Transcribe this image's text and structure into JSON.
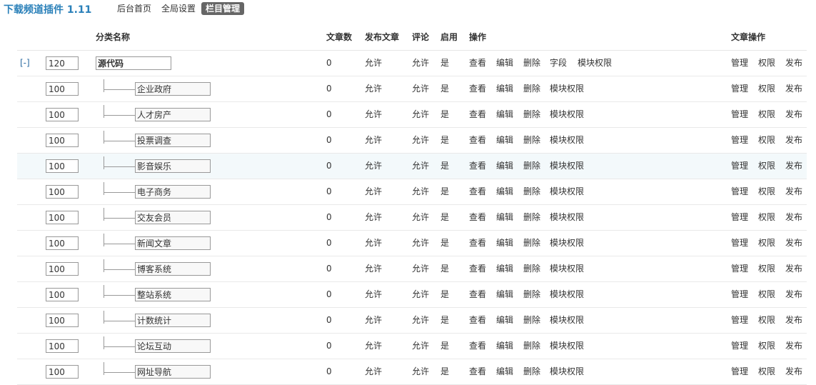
{
  "header": {
    "brand": "下载频道插件  1.11",
    "nav": [
      {
        "label": "后台首页",
        "active": false
      },
      {
        "label": "全局设置",
        "active": false
      },
      {
        "label": "栏目管理",
        "active": true
      }
    ]
  },
  "table": {
    "columns": {
      "name": "分类名称",
      "count": "文章数",
      "post": "发布文章",
      "comment": "评论",
      "enabled": "启用",
      "actions": "操作",
      "article_actions": "文章操作"
    },
    "toggle_label": "[-]",
    "root": {
      "order": "120",
      "name": "源代码",
      "count": "0",
      "post": "允许",
      "comment": "允许",
      "enabled": "是",
      "actions": [
        "查看",
        "编辑",
        "删除",
        "字段",
        "模块权限"
      ],
      "article_actions": [
        "管理",
        "权限",
        "发布"
      ]
    },
    "rows": [
      {
        "order": "100",
        "name": "企业政府",
        "count": "0",
        "post": "允许",
        "comment": "允许",
        "enabled": "是",
        "actions": [
          "查看",
          "编辑",
          "删除",
          "模块权限"
        ],
        "article_actions": [
          "管理",
          "权限",
          "发布"
        ]
      },
      {
        "order": "100",
        "name": "人才房产",
        "count": "0",
        "post": "允许",
        "comment": "允许",
        "enabled": "是",
        "actions": [
          "查看",
          "编辑",
          "删除",
          "模块权限"
        ],
        "article_actions": [
          "管理",
          "权限",
          "发布"
        ]
      },
      {
        "order": "100",
        "name": "投票调查",
        "count": "0",
        "post": "允许",
        "comment": "允许",
        "enabled": "是",
        "actions": [
          "查看",
          "编辑",
          "删除",
          "模块权限"
        ],
        "article_actions": [
          "管理",
          "权限",
          "发布"
        ]
      },
      {
        "order": "100",
        "name": "影音娱乐",
        "count": "0",
        "post": "允许",
        "comment": "允许",
        "enabled": "是",
        "actions": [
          "查看",
          "编辑",
          "删除",
          "模块权限"
        ],
        "article_actions": [
          "管理",
          "权限",
          "发布"
        ]
      },
      {
        "order": "100",
        "name": "电子商务",
        "count": "0",
        "post": "允许",
        "comment": "允许",
        "enabled": "是",
        "actions": [
          "查看",
          "编辑",
          "删除",
          "模块权限"
        ],
        "article_actions": [
          "管理",
          "权限",
          "发布"
        ]
      },
      {
        "order": "100",
        "name": "交友会员",
        "count": "0",
        "post": "允许",
        "comment": "允许",
        "enabled": "是",
        "actions": [
          "查看",
          "编辑",
          "删除",
          "模块权限"
        ],
        "article_actions": [
          "管理",
          "权限",
          "发布"
        ]
      },
      {
        "order": "100",
        "name": "新闻文章",
        "count": "0",
        "post": "允许",
        "comment": "允许",
        "enabled": "是",
        "actions": [
          "查看",
          "编辑",
          "删除",
          "模块权限"
        ],
        "article_actions": [
          "管理",
          "权限",
          "发布"
        ]
      },
      {
        "order": "100",
        "name": "博客系统",
        "count": "0",
        "post": "允许",
        "comment": "允许",
        "enabled": "是",
        "actions": [
          "查看",
          "编辑",
          "删除",
          "模块权限"
        ],
        "article_actions": [
          "管理",
          "权限",
          "发布"
        ]
      },
      {
        "order": "100",
        "name": "整站系统",
        "count": "0",
        "post": "允许",
        "comment": "允许",
        "enabled": "是",
        "actions": [
          "查看",
          "编辑",
          "删除",
          "模块权限"
        ],
        "article_actions": [
          "管理",
          "权限",
          "发布"
        ]
      },
      {
        "order": "100",
        "name": "计数统计",
        "count": "0",
        "post": "允许",
        "comment": "允许",
        "enabled": "是",
        "actions": [
          "查看",
          "编辑",
          "删除",
          "模块权限"
        ],
        "article_actions": [
          "管理",
          "权限",
          "发布"
        ]
      },
      {
        "order": "100",
        "name": "论坛互动",
        "count": "0",
        "post": "允许",
        "comment": "允许",
        "enabled": "是",
        "actions": [
          "查看",
          "编辑",
          "删除",
          "模块权限"
        ],
        "article_actions": [
          "管理",
          "权限",
          "发布"
        ]
      },
      {
        "order": "100",
        "name": "网址导航",
        "count": "0",
        "post": "允许",
        "comment": "允许",
        "enabled": "是",
        "actions": [
          "查看",
          "编辑",
          "删除",
          "模块权限"
        ],
        "article_actions": [
          "管理",
          "权限",
          "发布"
        ]
      }
    ]
  }
}
